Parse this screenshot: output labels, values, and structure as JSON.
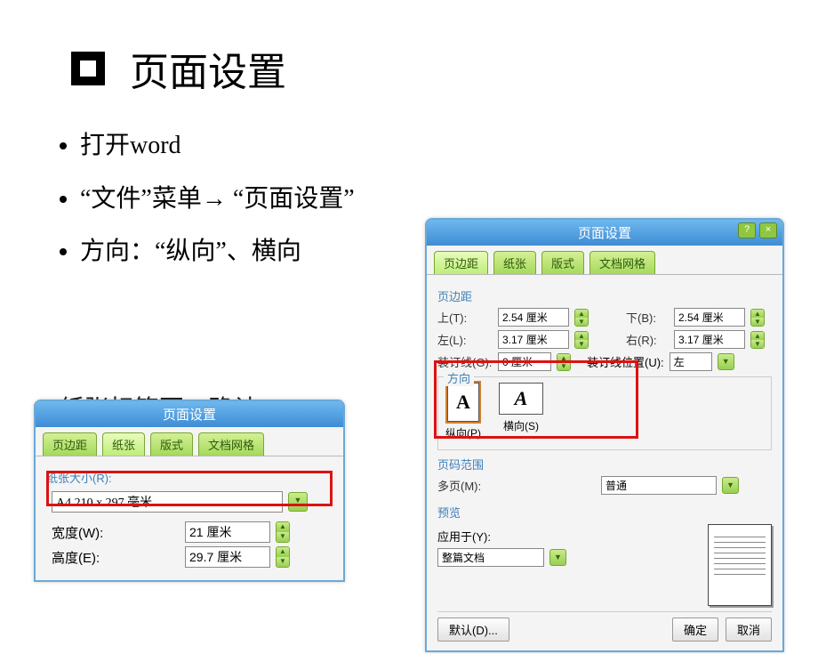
{
  "title": "页面设置",
  "bullets": {
    "b1": "打开word",
    "b2a": "“文件”菜单",
    "b2b": "“页面设置”",
    "b3": "方向：“纵向”、横向"
  },
  "dialog": {
    "title": "页面设置",
    "tabs": {
      "margins": "页边距",
      "paper": "纸张",
      "layout": "版式",
      "grid": "文档网格"
    },
    "margins_group": "页边距",
    "top_lbl": "上(T):",
    "top_val": "2.54 厘米",
    "bottom_lbl": "下(B):",
    "bottom_val": "2.54 厘米",
    "left_lbl": "左(L):",
    "left_val": "3.17 厘米",
    "right_lbl": "右(R):",
    "right_val": "3.17 厘米",
    "gutter_lbl": "装订线(G):",
    "gutter_val": "0 厘米",
    "gutter_pos_lbl": "装订线位置(U):",
    "gutter_pos_val": "左",
    "orient_group": "方向",
    "portrait": "纵向(P)",
    "landscape": "横向(S)",
    "pages_group": "页码范围",
    "multi_lbl": "多页(M):",
    "multi_val": "普通",
    "preview_group": "预览",
    "apply_lbl": "应用于(Y):",
    "apply_val": "整篇文档",
    "default_btn": "默认(D)...",
    "ok_btn": "确定",
    "cancel_btn": "取消"
  },
  "paper": {
    "title": "页面设置",
    "size_group": "纸张大小(R):",
    "size_val": "A4 210 x 297 毫米",
    "width_lbl": "宽度(W):",
    "width_val": "21 厘米",
    "height_lbl": "高度(E):",
    "height_val": "29.7 厘米"
  }
}
